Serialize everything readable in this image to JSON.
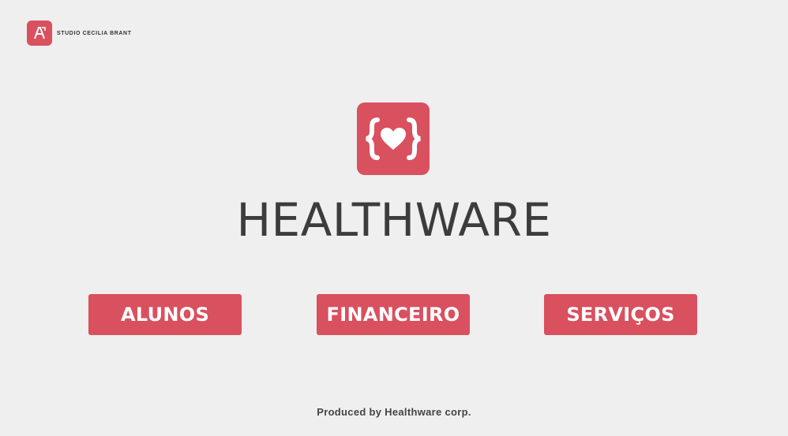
{
  "header": {
    "brand_text": "STUDIO CECILIA BRANT"
  },
  "app": {
    "title": "HEALTHWARE",
    "logo_icon": "code-heart-icon"
  },
  "menu": {
    "alunos_label": "ALUNOS",
    "financeiro_label": "FINANCEIRO",
    "servicos_label": "SERVIÇOS"
  },
  "footer": {
    "text": "Produced by Healthware corp."
  },
  "colors": {
    "accent": "#d9505f",
    "background": "#efefef",
    "title": "#3c3c3c"
  }
}
